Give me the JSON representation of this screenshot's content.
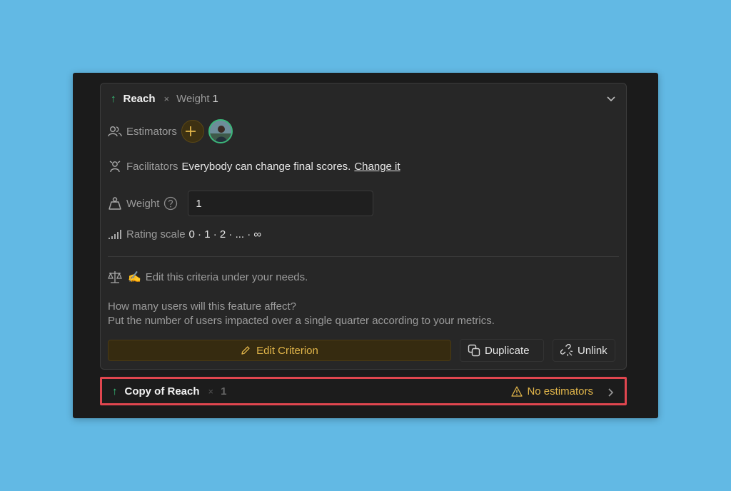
{
  "criterion": {
    "title": "Reach",
    "times": "×",
    "weight_label": "Weight",
    "weight_value": "1"
  },
  "estimators": {
    "label": "Estimators"
  },
  "facilitators": {
    "label": "Facilitators",
    "text": "Everybody can change final scores.",
    "link": "Change it"
  },
  "weight": {
    "label": "Weight",
    "value": "1"
  },
  "rating_scale": {
    "label": "Rating scale",
    "value": "0 · 1 · 2 · ... · ∞"
  },
  "edit_note": {
    "emoji": "✍️",
    "text": "Edit this criteria under your needs."
  },
  "description": {
    "line1": "How many users will this feature affect?",
    "line2": "Put the number of users impacted over a single quarter according to your metrics."
  },
  "actions": {
    "edit": "Edit Criterion",
    "duplicate": "Duplicate",
    "unlink": "Unlink"
  },
  "copy": {
    "title": "Copy of Reach",
    "times": "×",
    "weight": "1",
    "warning": "No estimators"
  },
  "colors": {
    "background": "#62b9e4",
    "accent": "#e2b64a",
    "up_arrow": "#37c27a",
    "highlight": "#e0464f"
  }
}
